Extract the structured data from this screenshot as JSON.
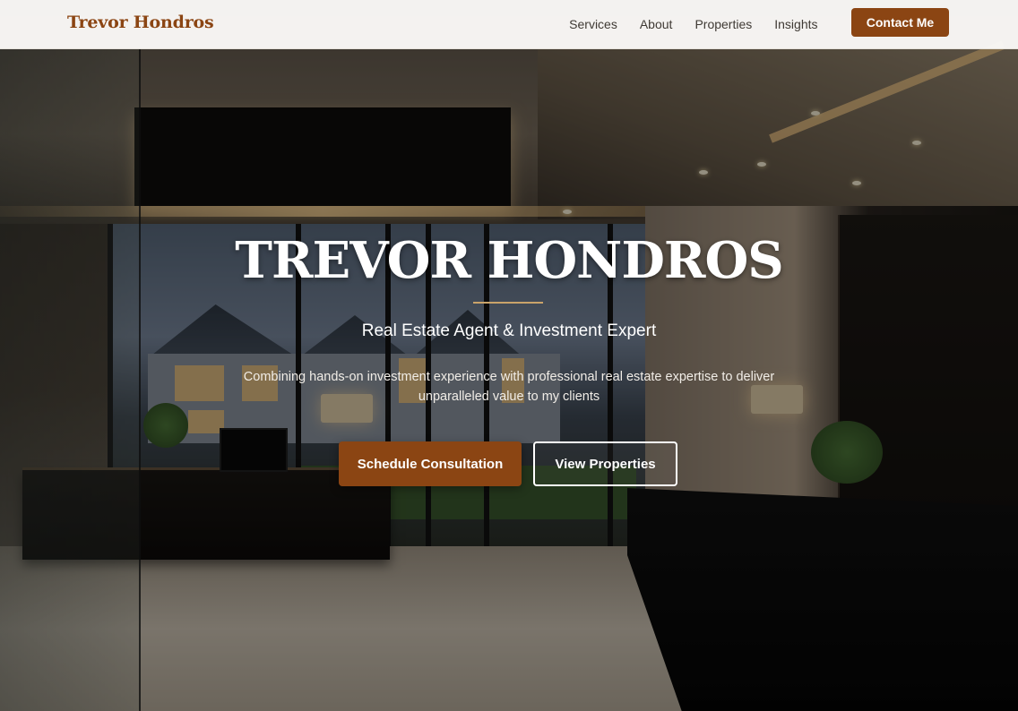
{
  "nav": {
    "brand": "Trevor Hondros",
    "links": [
      "Services",
      "About",
      "Properties",
      "Insights"
    ],
    "cta": "Contact Me"
  },
  "hero": {
    "title": "TREVOR HONDROS",
    "subtitle": "Real Estate Agent & Investment Expert",
    "description": "Combining hands-on investment experience with professional real estate expertise to deliver unparalleled value to my clients",
    "primary_button": "Schedule Consultation",
    "secondary_button": "View Properties"
  },
  "colors": {
    "brand": "#8b4513",
    "accent_divider": "#c9a36a",
    "nav_background": "#faf9f7"
  },
  "background_image": "luxury-office-interior"
}
